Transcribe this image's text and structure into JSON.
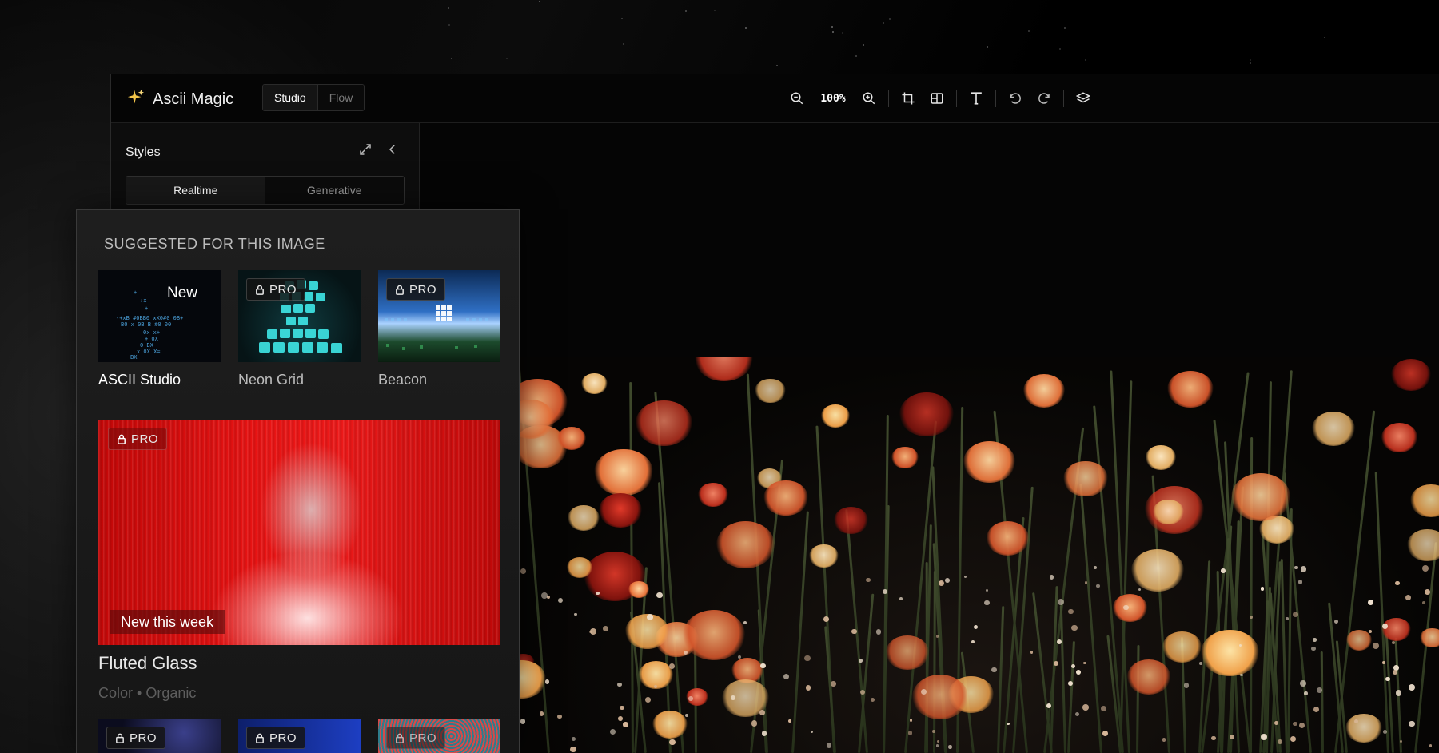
{
  "app": {
    "name": "Ascii Magic",
    "modes": [
      {
        "label": "Studio",
        "active": true
      },
      {
        "label": "Flow",
        "active": false
      }
    ]
  },
  "toolbar": {
    "zoom_level": "100%",
    "icons": [
      "zoom-out-icon",
      "zoom-in-icon",
      "crop-icon",
      "compare-icon",
      "text-icon",
      "undo-icon",
      "redo-icon",
      "layers-icon"
    ]
  },
  "styles_panel": {
    "title": "Styles",
    "tabs": [
      {
        "label": "Realtime",
        "active": true
      },
      {
        "label": "Generative",
        "active": false
      }
    ]
  },
  "suggestions": {
    "heading": "SUGGESTED FOR THIS IMAGE",
    "items": [
      {
        "name": "ASCII Studio",
        "badge": "New"
      },
      {
        "name": "Neon Grid",
        "badge": "PRO"
      },
      {
        "name": "Beacon",
        "badge": "PRO"
      }
    ],
    "featured": {
      "name": "Fluted Glass",
      "badge": "PRO",
      "ribbon": "New this week",
      "tags": "Color • Organic"
    },
    "more": [
      {
        "badge": "PRO"
      },
      {
        "badge": "PRO"
      },
      {
        "badge": "PRO"
      }
    ]
  },
  "colors": {
    "accent_red": "#e81616",
    "neon_cyan": "#27d6d6",
    "beacon_blue": "#2f6fc4"
  }
}
